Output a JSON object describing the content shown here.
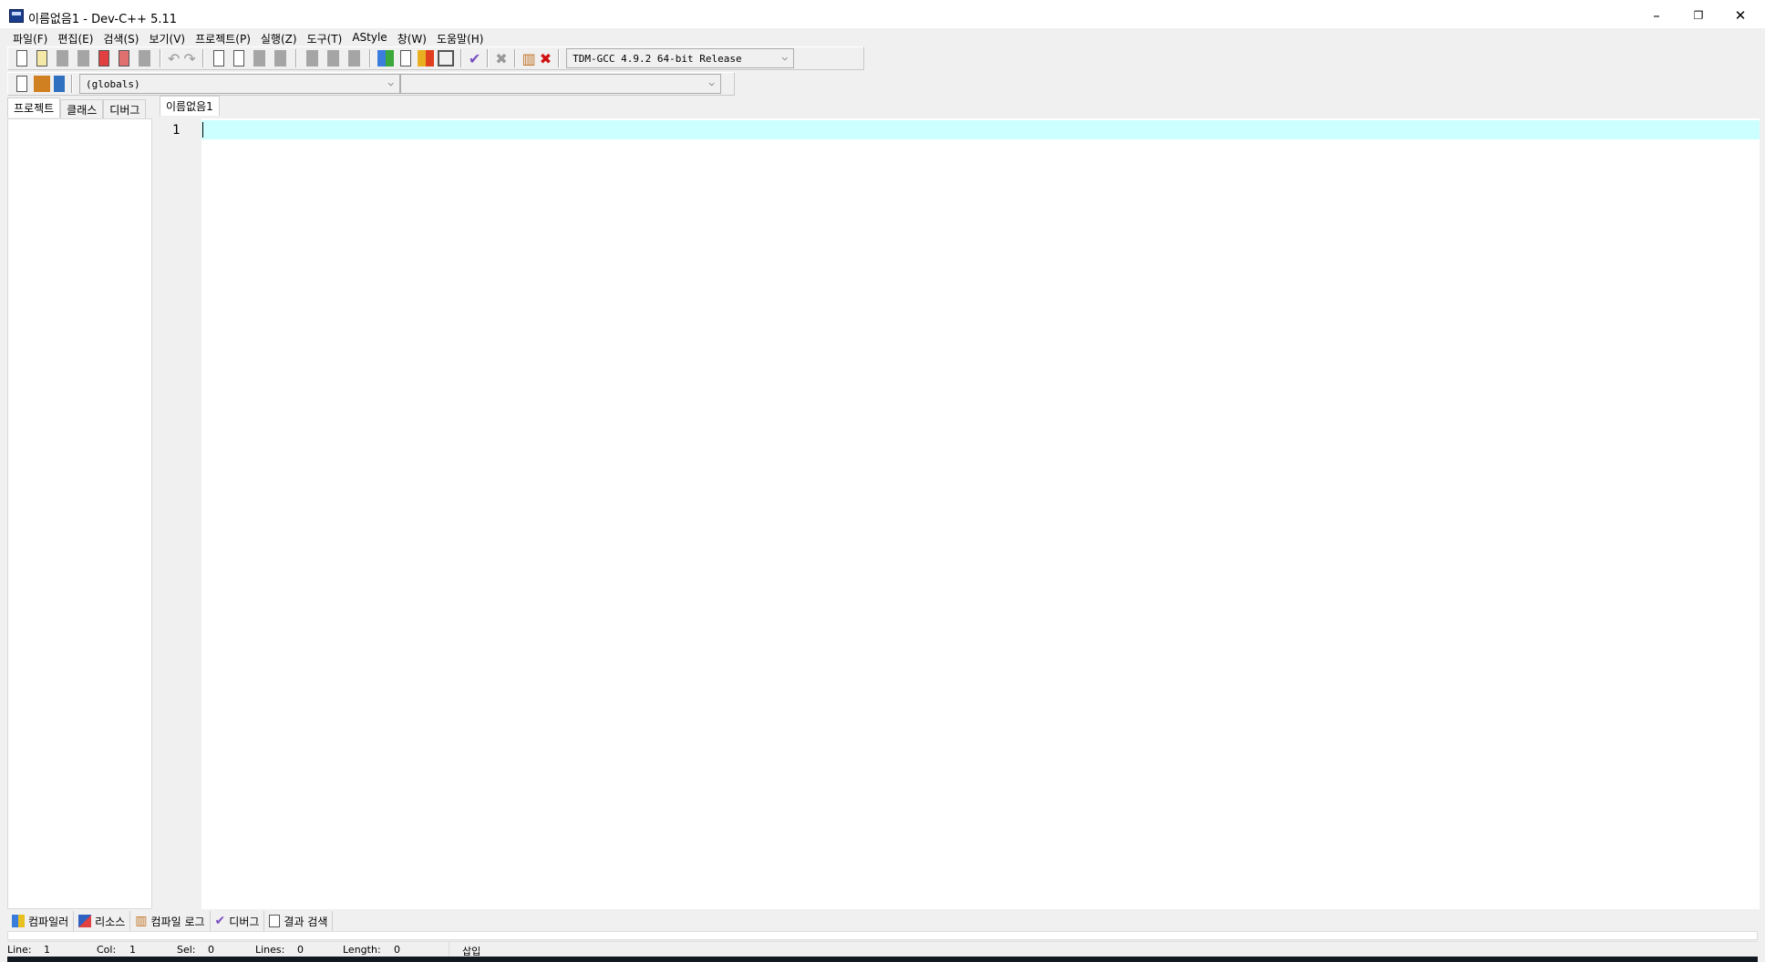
{
  "window": {
    "title": "이름없음1 - Dev-C++ 5.11",
    "minimize": "–",
    "restore": "❐",
    "close": "✕"
  },
  "menu": [
    "파일(F)",
    "편집(E)",
    "검색(S)",
    "보기(V)",
    "프로젝트(P)",
    "실행(Z)",
    "도구(T)",
    "AStyle",
    "창(W)",
    "도움말(H)"
  ],
  "toolbar": {
    "compiler": "TDM-GCC 4.9.2 64-bit Release",
    "scope": "(globals)",
    "member": ""
  },
  "left_tabs": [
    "프로젝트",
    "클래스",
    "디버그"
  ],
  "editor": {
    "tab": "이름없음1",
    "line_number": "1",
    "highlight_color": "#ccffff"
  },
  "bottom_tabs": [
    "컴파일러",
    "리소스",
    "컴파일 로그",
    "디버그",
    "결과 검색"
  ],
  "status": {
    "line_label": "Line:",
    "line": "1",
    "col_label": "Col:",
    "col": "1",
    "sel_label": "Sel:",
    "sel": "0",
    "lines_label": "Lines:",
    "lines": "0",
    "length_label": "Length:",
    "length": "0",
    "mode": "삽입"
  }
}
